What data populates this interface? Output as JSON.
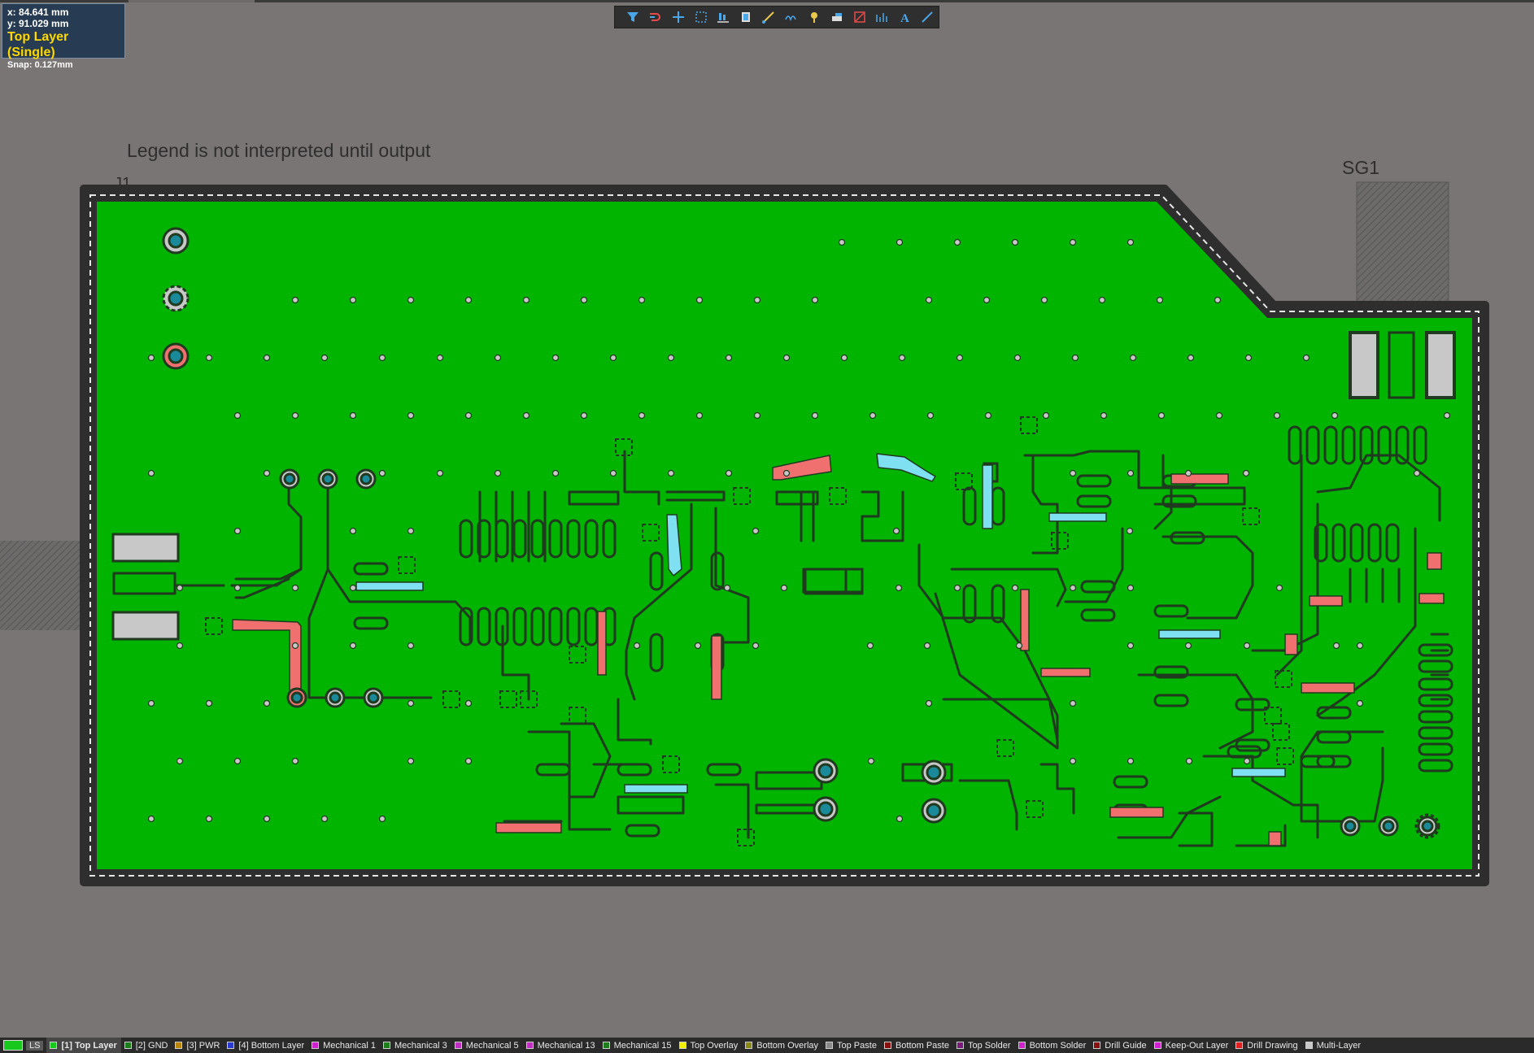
{
  "coord_panel": {
    "x": "x: 84.641 mm",
    "y": "y: 91.029  mm",
    "layer": "Top Layer (Single)",
    "snap": "Snap: 0.127mm"
  },
  "toolbar": {
    "tools": [
      {
        "name": "filter-icon"
      },
      {
        "name": "route-icon"
      },
      {
        "name": "cross-icon"
      },
      {
        "name": "select-rect-icon"
      },
      {
        "name": "align-icon"
      },
      {
        "name": "component-icon"
      },
      {
        "name": "interactive-route-icon"
      },
      {
        "name": "diff-pair-icon"
      },
      {
        "name": "tune-icon"
      },
      {
        "name": "via-icon"
      },
      {
        "name": "polygon-icon"
      },
      {
        "name": "fill-icon"
      },
      {
        "name": "dimension-icon"
      },
      {
        "name": "text-icon"
      },
      {
        "name": "line-icon"
      }
    ]
  },
  "canvas": {
    "legend_note": "Legend is not interpreted until output",
    "designator_j1": "J1",
    "designator_sg1": "SG1",
    "colors": {
      "background": "#7a7575",
      "board_copper": "#00b400",
      "board_outline": "#2e2e2e",
      "pad_gray": "#c8c8c8",
      "bottom_layer_trace": "#f07070",
      "inner_trace_cyan": "#7ee0f0",
      "via_center": "#1a8a9a"
    }
  },
  "status_bar": {
    "ls_label": "LS",
    "layers": [
      {
        "label": "[1] Top Layer",
        "color": "#19c81c",
        "active": true
      },
      {
        "label": "[2] GND",
        "color": "#1e7e1e",
        "active": false
      },
      {
        "label": "[3] PWR",
        "color": "#b8860b",
        "active": false
      },
      {
        "label": "[4] Bottom Layer",
        "color": "#2a3bd0",
        "active": false
      },
      {
        "label": "Mechanical 1",
        "color": "#d020d0",
        "active": false
      },
      {
        "label": "Mechanical 3",
        "color": "#1e7e1e",
        "active": false
      },
      {
        "label": "Mechanical 5",
        "color": "#c030c0",
        "active": false
      },
      {
        "label": "Mechanical 13",
        "color": "#c030c0",
        "active": false
      },
      {
        "label": "Mechanical 15",
        "color": "#1e7e1e",
        "active": false
      },
      {
        "label": "Top Overlay",
        "color": "#f0f000",
        "active": false
      },
      {
        "label": "Bottom Overlay",
        "color": "#8a8a10",
        "active": false
      },
      {
        "label": "Top Paste",
        "color": "#8a8a8a",
        "active": false
      },
      {
        "label": "Bottom Paste",
        "color": "#8a1010",
        "active": false
      },
      {
        "label": "Top Solder",
        "color": "#7a1a7a",
        "active": false
      },
      {
        "label": "Bottom Solder",
        "color": "#d020d0",
        "active": false
      },
      {
        "label": "Drill Guide",
        "color": "#8a1010",
        "active": false
      },
      {
        "label": "Keep-Out Layer",
        "color": "#d020d0",
        "active": false
      },
      {
        "label": "Drill Drawing",
        "color": "#e02020",
        "active": false
      },
      {
        "label": "Multi-Layer",
        "color": "#c8c8c8",
        "active": false
      }
    ]
  }
}
